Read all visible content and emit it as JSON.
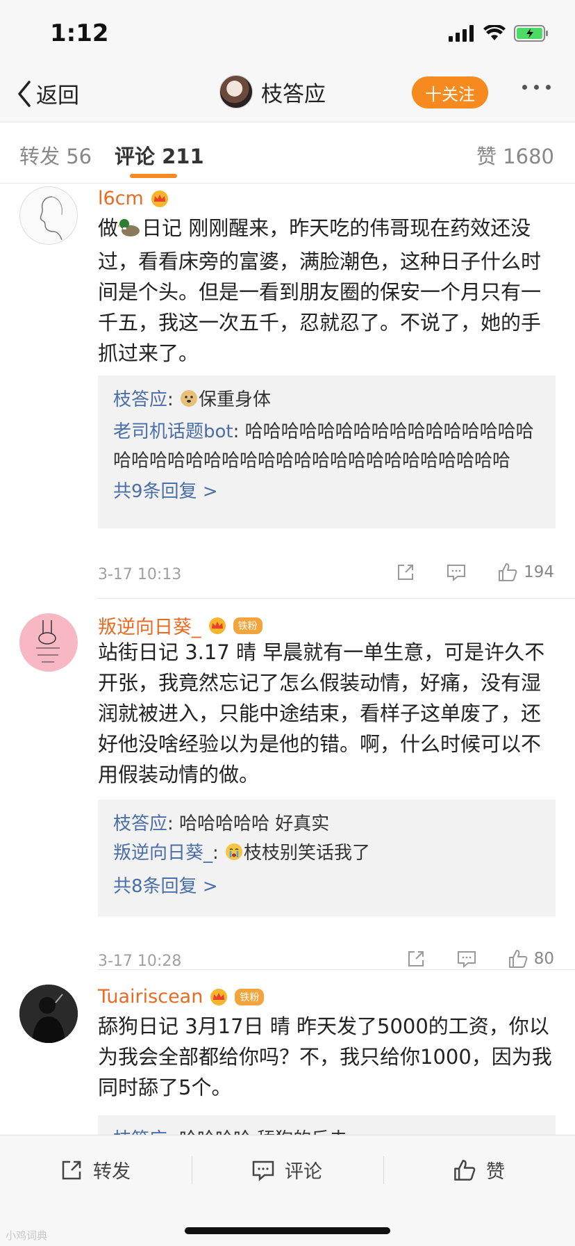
{
  "status_bar": {
    "time": "1:12"
  },
  "navbar": {
    "back_label": "返回",
    "title": "枝答应",
    "follow_label": "十关注"
  },
  "tabs": {
    "repost": "转发 56",
    "comments": "评论 211",
    "likes": "赞 1680"
  },
  "comments": [
    {
      "name": "l6cm",
      "text_prefix": "做",
      "text": "日记 刚刚醒来，昨天吃的伟哥现在药效还没过，看看床旁的富婆，满脸潮色，这种日子什么时间是个头。但是一看到朋友圈的保安一个月只有一千五，我这一次五千，忍就忍了。不说了，她的手抓过来了。",
      "emoji_icon": "duck-emoji",
      "replies": [
        {
          "name": "枝答应",
          "text": "保重身体",
          "emoji_icon": "doge-emoji"
        },
        {
          "name": "老司机话题bot",
          "text": "哈哈哈哈哈哈哈哈哈哈哈哈哈哈哈哈哈哈哈哈哈哈哈哈哈哈哈哈哈哈哈哈哈哈哈哈哈哈"
        }
      ],
      "more_replies": "共9条回复 >",
      "time": "3-17 10:13",
      "like_count": "194"
    },
    {
      "name": "叛逆向日葵_",
      "badge": "铁粉",
      "text": "站街日记 3.17 晴 早晨就有一单生意，可是许久不开张，我竟然忘记了怎么假装动情，好痛，没有湿润就被进入，只能中途结束，看样子这单废了，还好他没啥经验以为是他的错。啊，什么时候可以不用假装动情的做。",
      "replies": [
        {
          "name": "枝答应",
          "text": "哈哈哈哈哈 好真实"
        },
        {
          "name": "叛逆向日葵_",
          "text": "枝枝别笑话我了",
          "emoji_icon": "crying-emoji"
        }
      ],
      "more_replies": "共8条回复 >",
      "time": "3-17 10:28",
      "like_count": "80"
    },
    {
      "name": "Tuairiscean",
      "badge": "铁粉",
      "text": "舔狗日记 3月17日 晴 昨天发了5000的工资，你以为我会全部都给你吗？不，我只给你1000，因为我同时舔了5个。",
      "replies": [
        {
          "name": "枝答应",
          "text": "哈哈哈哈 舔狗的反击"
        }
      ]
    }
  ],
  "bottom_bar": {
    "repost": "转发",
    "comment": "评论",
    "like": "赞"
  },
  "watermark": "小鸡词典",
  "colors": {
    "accent": "#f68a1e",
    "username": "#e86b21",
    "reply_name": "#4a6ea8"
  }
}
